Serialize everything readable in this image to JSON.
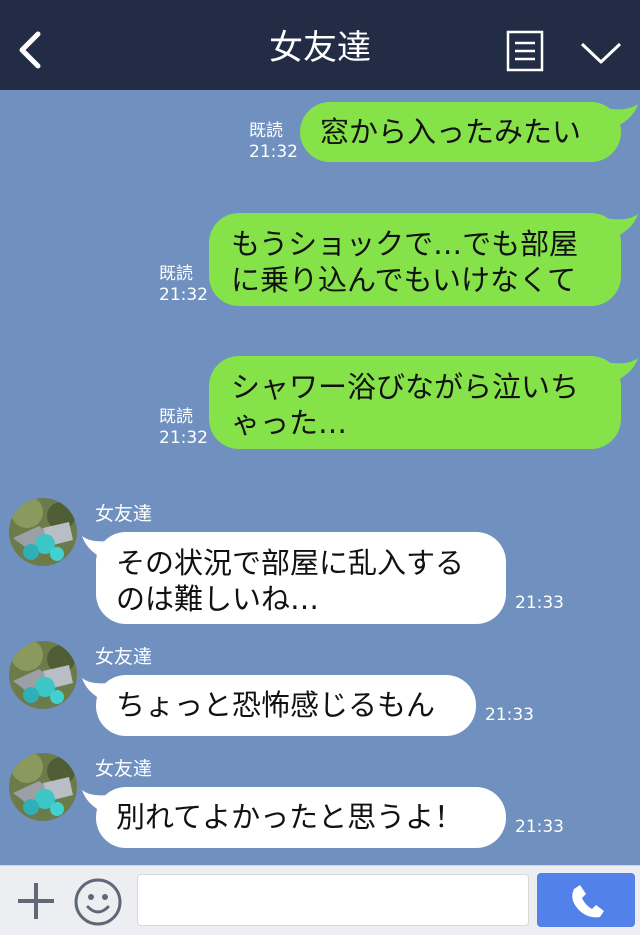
{
  "header": {
    "title": "女友達",
    "back_icon": "chevron-left-icon",
    "menu_icon": "menu-list-icon",
    "collapse_icon": "chevron-down-icon",
    "background": "#222c45"
  },
  "chat": {
    "background": "#7090c0",
    "outgoing_bubble_color": "#85e249",
    "incoming_bubble_color": "#ffffff",
    "messages": [
      {
        "direction": "out",
        "lines": [
          "窓から入ったみたい"
        ],
        "read_label": "既読",
        "time": "21:32"
      },
      {
        "direction": "out",
        "lines": [
          "もうショックで…でも部屋",
          "に乗り込んでもいけなくて"
        ],
        "read_label": "既読",
        "time": "21:32"
      },
      {
        "direction": "out",
        "lines": [
          "シャワー浴びながら泣いち",
          "ゃった…"
        ],
        "read_label": "既読",
        "time": "21:32"
      },
      {
        "direction": "in",
        "sender": "女友達",
        "lines": [
          "その状況で部屋に乱入する",
          "のは難しいね…"
        ],
        "time": "21:33"
      },
      {
        "direction": "in",
        "sender": "女友達",
        "lines": [
          "ちょっと恐怖感じるもん"
        ],
        "time": "21:33"
      },
      {
        "direction": "in",
        "sender": "女友達",
        "lines": [
          "別れてよかったと思うよ！"
        ],
        "time": "21:33"
      }
    ]
  },
  "composer": {
    "plus_icon": "plus-icon",
    "emoji_icon": "emoji-icon",
    "input_value": "",
    "call_icon": "phone-icon",
    "call_button_color": "#5381ea"
  }
}
